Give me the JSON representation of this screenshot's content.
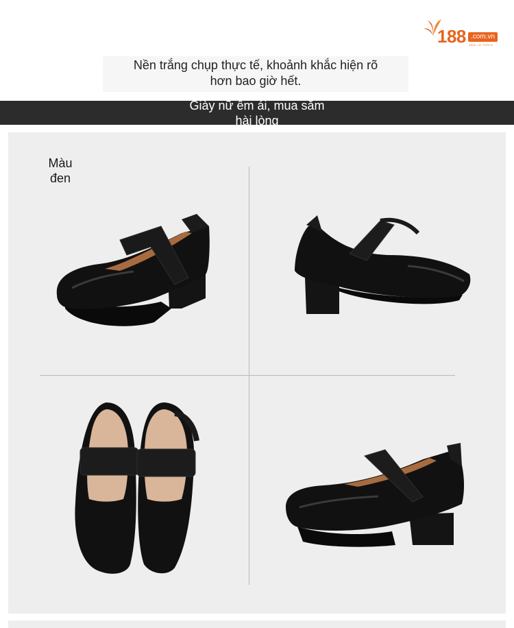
{
  "brand": {
    "logo_text": "188",
    "domain": ".com.vn",
    "tagline": "XEM LÀ THÍCH",
    "color": "#e8641c"
  },
  "intro": {
    "line1": "Nền trắng chụp thực tế, khoảnh khắc hiện rõ",
    "line2": "hơn bao giờ hết."
  },
  "banner": {
    "line1": "Giày nữ êm ái, mua sắm",
    "line2": "hài lòng"
  },
  "product": {
    "color_label_line1": "Màu",
    "color_label_line2": "đen",
    "shoe_color": "#111111",
    "photos": [
      "shoe-front-quarter-view",
      "shoe-back-quarter-view",
      "shoe-pair-top-view",
      "shoe-side-view"
    ]
  }
}
